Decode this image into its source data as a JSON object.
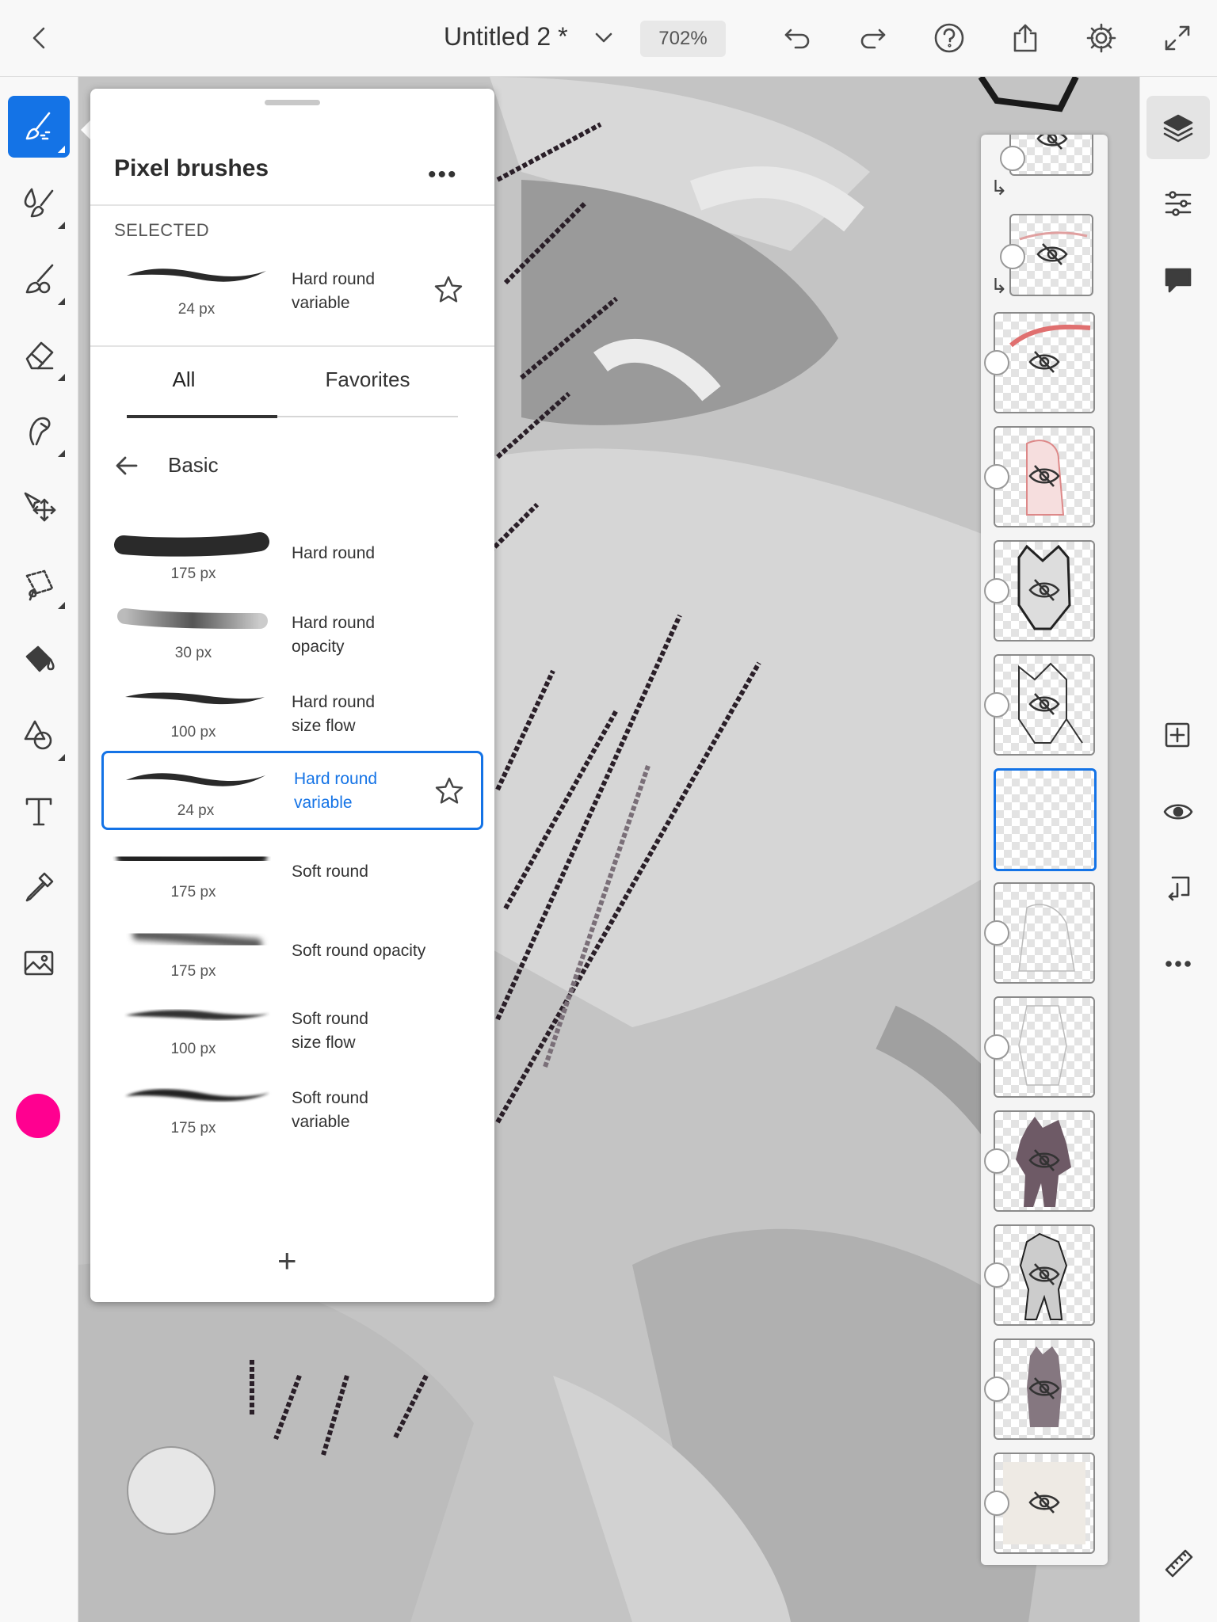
{
  "topbar": {
    "doc_title": "Untitled 2 *",
    "zoom": "702%",
    "icons": [
      "back-icon",
      "chevron-down-icon",
      "undo-icon",
      "redo-icon",
      "help-icon",
      "share-icon",
      "gear-icon",
      "fullscreen-icon"
    ]
  },
  "left_toolbar": {
    "tools": [
      "pixel-brush-icon",
      "live-brush-icon",
      "mixer-brush-icon",
      "eraser-icon",
      "smudge-icon",
      "transform-icon",
      "lasso-icon",
      "fill-icon",
      "shape-icon",
      "text-icon",
      "eyedropper-icon",
      "image-icon"
    ],
    "active_tool": "pixel-brush-icon",
    "current_color": "#ff0090"
  },
  "right_toolbar": {
    "icons": [
      "layers-icon",
      "adjustments-icon",
      "comment-icon",
      "add-layer-icon",
      "visibility-icon",
      "merge-down-icon",
      "more-icon",
      "ruler-icon"
    ]
  },
  "brush_panel": {
    "title": "Pixel brushes",
    "more_label": "•••",
    "selected_heading": "SELECTED",
    "selected_brush": {
      "name": "Hard round\nvariable",
      "size": "24 px"
    },
    "tabs": [
      {
        "label": "All",
        "active": true
      },
      {
        "label": "Favorites",
        "active": false
      }
    ],
    "group_name": "Basic",
    "brushes": [
      {
        "name": "Hard round",
        "size": "175 px"
      },
      {
        "name": "Hard round\nopacity",
        "size": "30 px"
      },
      {
        "name": "Hard round\nsize flow",
        "size": "100 px"
      },
      {
        "name": "Hard round\nvariable",
        "size": "24 px",
        "selected": true
      },
      {
        "name": "Soft round",
        "size": "175 px"
      },
      {
        "name": "Soft round opacity",
        "size": "175 px"
      },
      {
        "name": "Soft round\nsize flow",
        "size": "100 px"
      },
      {
        "name": "Soft round\nvariable",
        "size": "175 px"
      }
    ],
    "add_label": "+"
  },
  "layers": {
    "count": 13,
    "selected_index": 6,
    "colors": {
      "accent": "#1473e6"
    }
  }
}
